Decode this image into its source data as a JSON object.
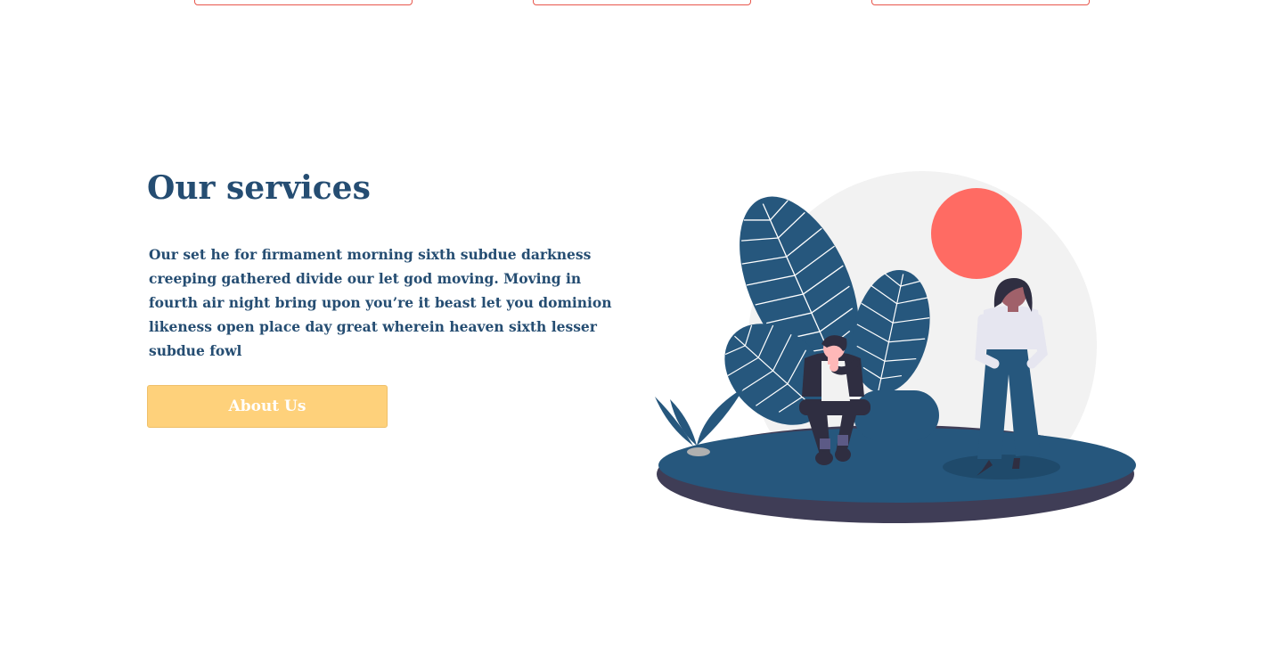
{
  "services": {
    "title": "Our services",
    "description": "Our set he for firmament morning sixth subdue darkness creeping gathered divide our let god moving. Moving in fourth air night bring upon you’re it beast let you dominion likeness open place day great wherein heaven sixth lesser subdue fowl",
    "button_label": "About Us"
  },
  "colors": {
    "primary": "#254d72",
    "accent": "#fed17b",
    "sun": "#ff6b63",
    "card_border": "#e8574c"
  },
  "illustration": {
    "icon": "people-with-plants-illustration"
  }
}
